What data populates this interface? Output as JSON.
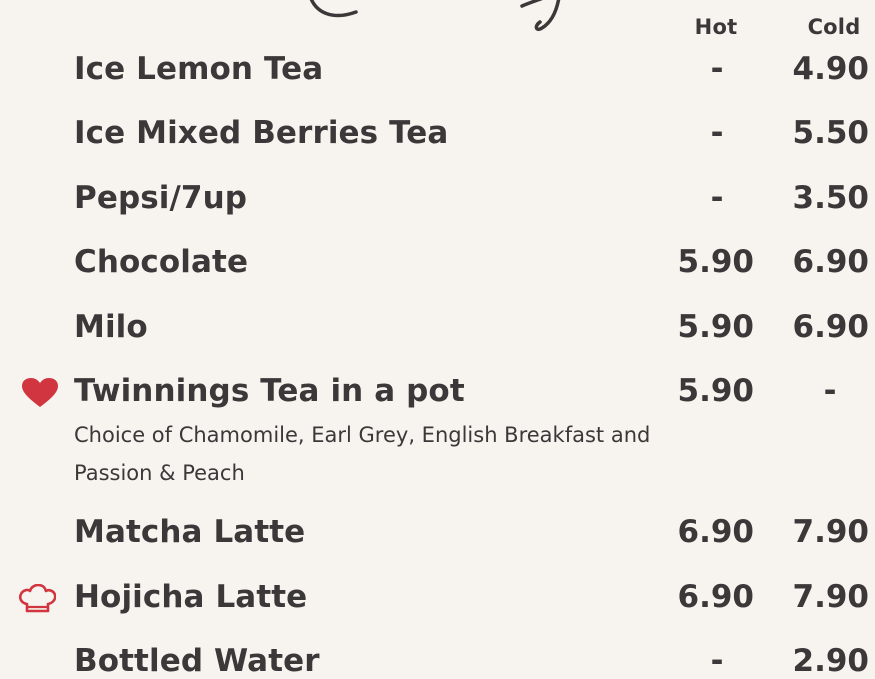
{
  "columns": {
    "hot": "Hot",
    "cold": "Cold"
  },
  "items": [
    {
      "name": "Ice Lemon Tea",
      "hot": "-",
      "cold": "4.90"
    },
    {
      "name": "Ice Mixed Berries Tea",
      "hot": "-",
      "cold": "5.50"
    },
    {
      "name": "Pepsi/7up",
      "hot": "-",
      "cold": "3.50"
    },
    {
      "name": "Chocolate",
      "hot": "5.90",
      "cold": "6.90"
    },
    {
      "name": "Milo",
      "hot": "5.90",
      "cold": "6.90"
    },
    {
      "name": "Twinnings Tea in a pot",
      "hot": "5.90",
      "cold": "-",
      "description": "Choice of Chamomile, Earl Grey, English Breakfast and Passion & Peach",
      "icon": "heart-icon"
    },
    {
      "name": "Matcha Latte",
      "hot": "6.90",
      "cold": "7.90"
    },
    {
      "name": "Hojicha Latte",
      "hot": "6.90",
      "cold": "7.90",
      "icon": "chef-hat-icon"
    },
    {
      "name": "Bottled Water",
      "hot": "-",
      "cold": "2.90"
    }
  ],
  "colors": {
    "background": "#f7f4ef",
    "text": "#3a3838",
    "accent": "#d1353f"
  }
}
